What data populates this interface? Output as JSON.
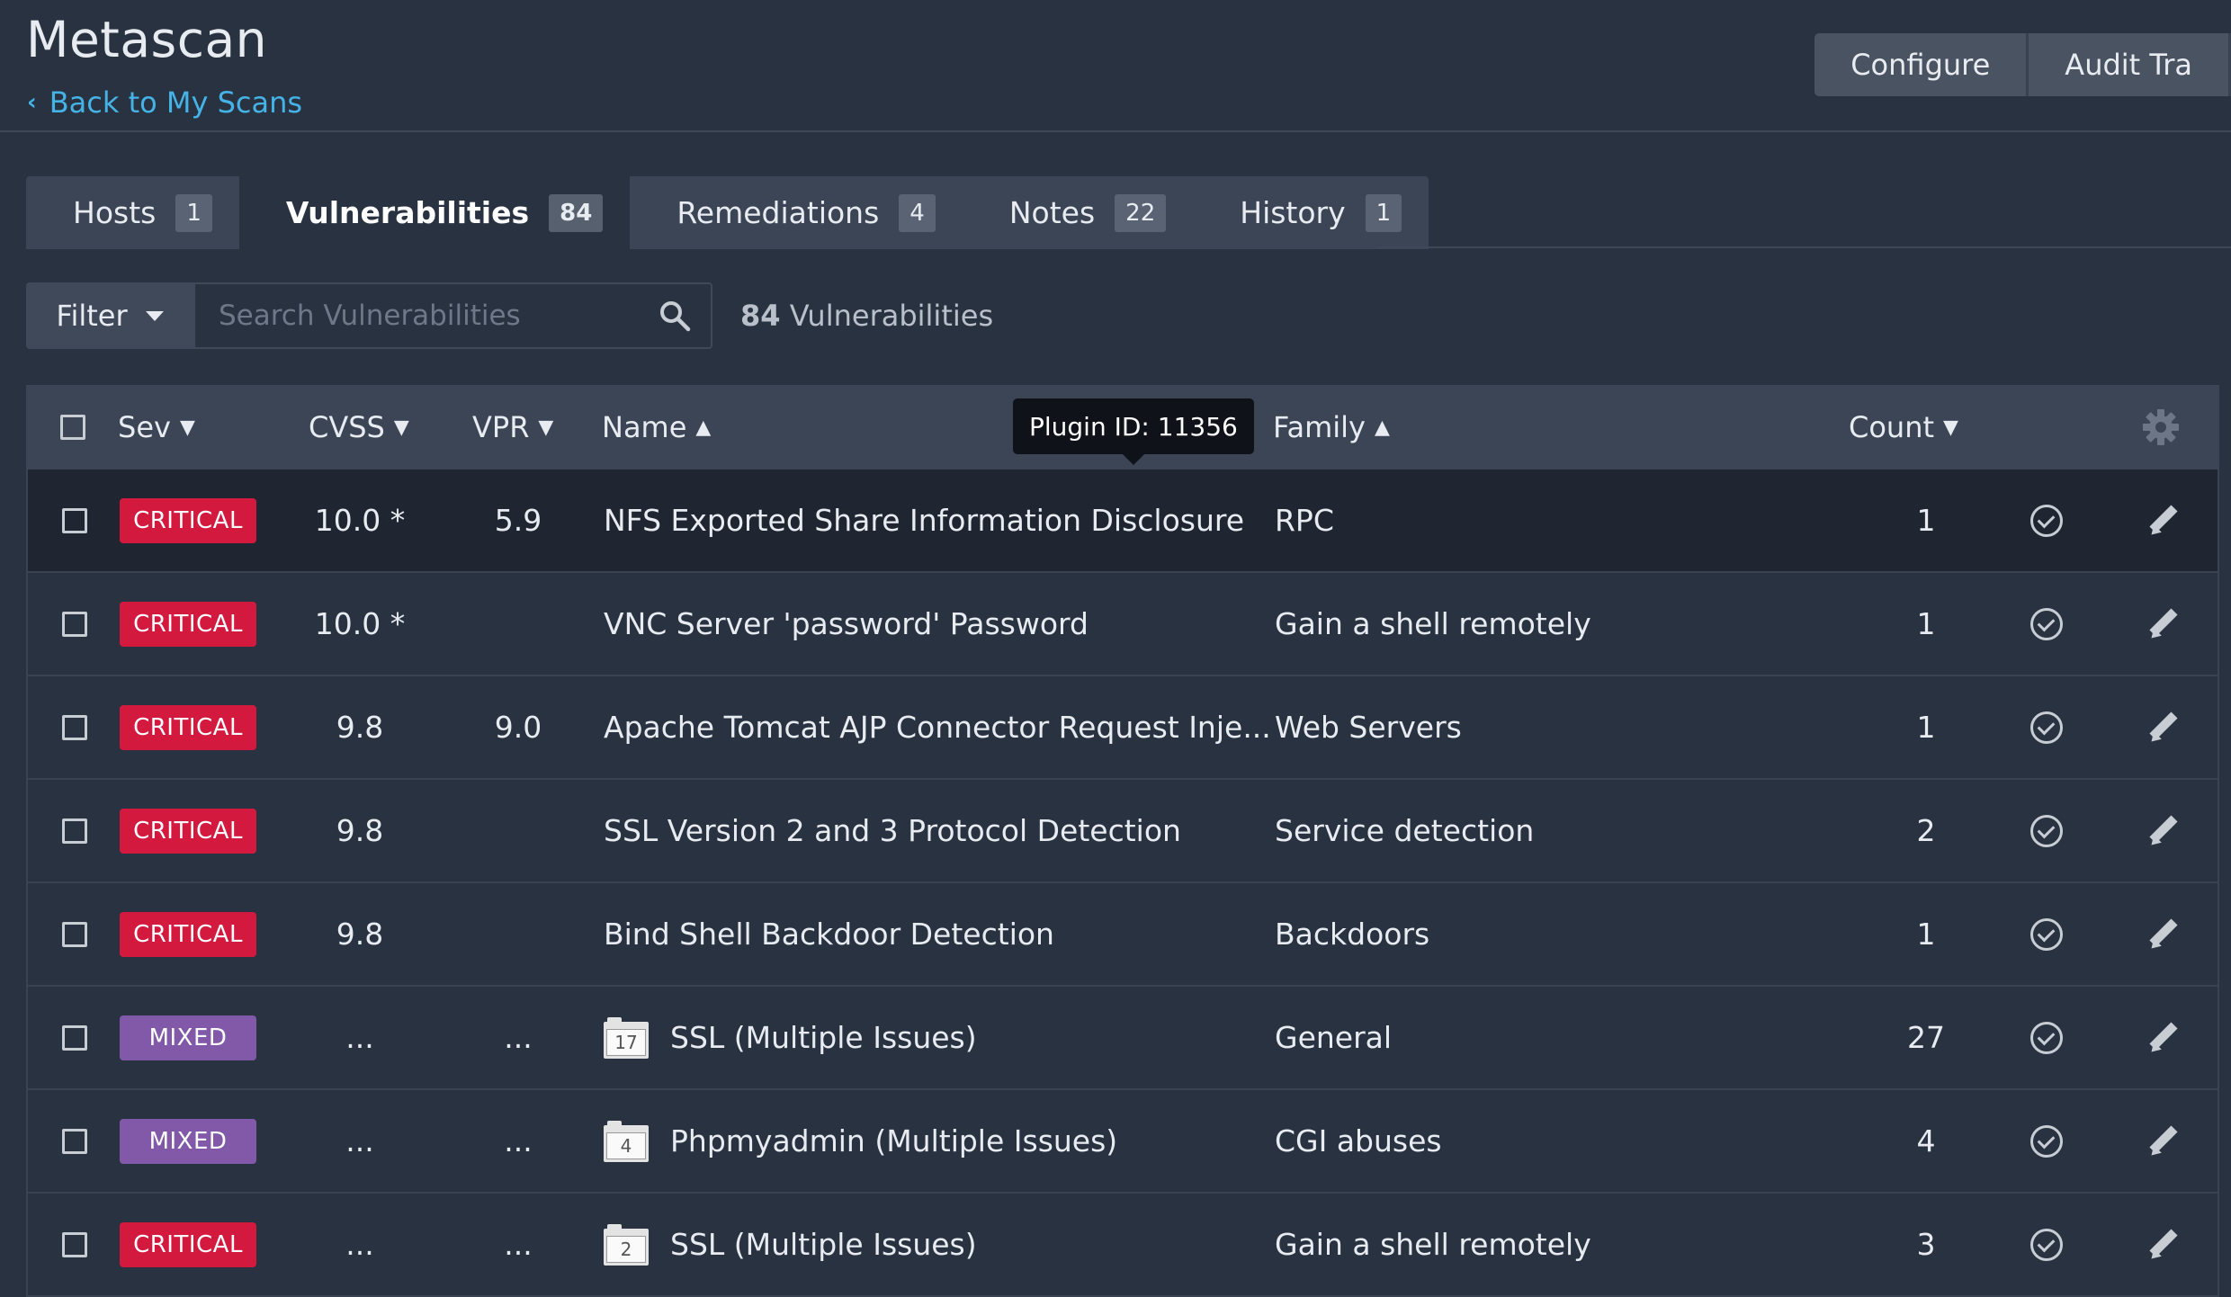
{
  "header": {
    "title": "Metascan",
    "back_label": "Back to My Scans",
    "buttons": [
      "Configure",
      "Audit Tra"
    ]
  },
  "tabs": [
    {
      "label": "Hosts",
      "count": "1"
    },
    {
      "label": "Vulnerabilities",
      "count": "84",
      "active": true
    },
    {
      "label": "Remediations",
      "count": "4"
    },
    {
      "label": "Notes",
      "count": "22"
    },
    {
      "label": "History",
      "count": "1"
    }
  ],
  "filter": {
    "label": "Filter",
    "search_placeholder": "Search Vulnerabilities",
    "count_num": "84",
    "count_label": "Vulnerabilities"
  },
  "tooltip": "Plugin ID: 11356",
  "columns": {
    "sev": "Sev",
    "cvss": "CVSS",
    "vpr": "VPR",
    "name": "Name",
    "family": "Family",
    "count": "Count",
    "sort_down": "▼",
    "sort_up": "▲"
  },
  "rows": [
    {
      "sev": "CRITICAL",
      "sev_type": "critical",
      "cvss": "10.0 *",
      "vpr": "5.9",
      "name": "NFS Exported Share Information Disclosure",
      "group": "",
      "family": "RPC",
      "count": "1"
    },
    {
      "sev": "CRITICAL",
      "sev_type": "critical",
      "cvss": "10.0 *",
      "vpr": "",
      "name": "VNC Server 'password' Password",
      "group": "",
      "family": "Gain a shell remotely",
      "count": "1"
    },
    {
      "sev": "CRITICAL",
      "sev_type": "critical",
      "cvss": "9.8",
      "vpr": "9.0",
      "name": "Apache Tomcat AJP Connector Request Inje...",
      "group": "",
      "family": "Web Servers",
      "count": "1"
    },
    {
      "sev": "CRITICAL",
      "sev_type": "critical",
      "cvss": "9.8",
      "vpr": "",
      "name": "SSL Version 2 and 3 Protocol Detection",
      "group": "",
      "family": "Service detection",
      "count": "2"
    },
    {
      "sev": "CRITICAL",
      "sev_type": "critical",
      "cvss": "9.8",
      "vpr": "",
      "name": "Bind Shell Backdoor Detection",
      "group": "",
      "family": "Backdoors",
      "count": "1"
    },
    {
      "sev": "MIXED",
      "sev_type": "mixed",
      "cvss": "...",
      "vpr": "...",
      "name": "SSL (Multiple Issues)",
      "group": "17",
      "family": "General",
      "count": "27"
    },
    {
      "sev": "MIXED",
      "sev_type": "mixed",
      "cvss": "...",
      "vpr": "...",
      "name": "Phpmyadmin (Multiple Issues)",
      "group": "4",
      "family": "CGI abuses",
      "count": "4"
    },
    {
      "sev": "CRITICAL",
      "sev_type": "critical",
      "cvss": "...",
      "vpr": "...",
      "name": "SSL (Multiple Issues)",
      "group": "2",
      "family": "Gain a shell remotely",
      "count": "3"
    }
  ],
  "colors": {
    "background": "#283241",
    "critical": "#d4193f",
    "mixed": "#8159a8",
    "link": "#46b3e6"
  }
}
